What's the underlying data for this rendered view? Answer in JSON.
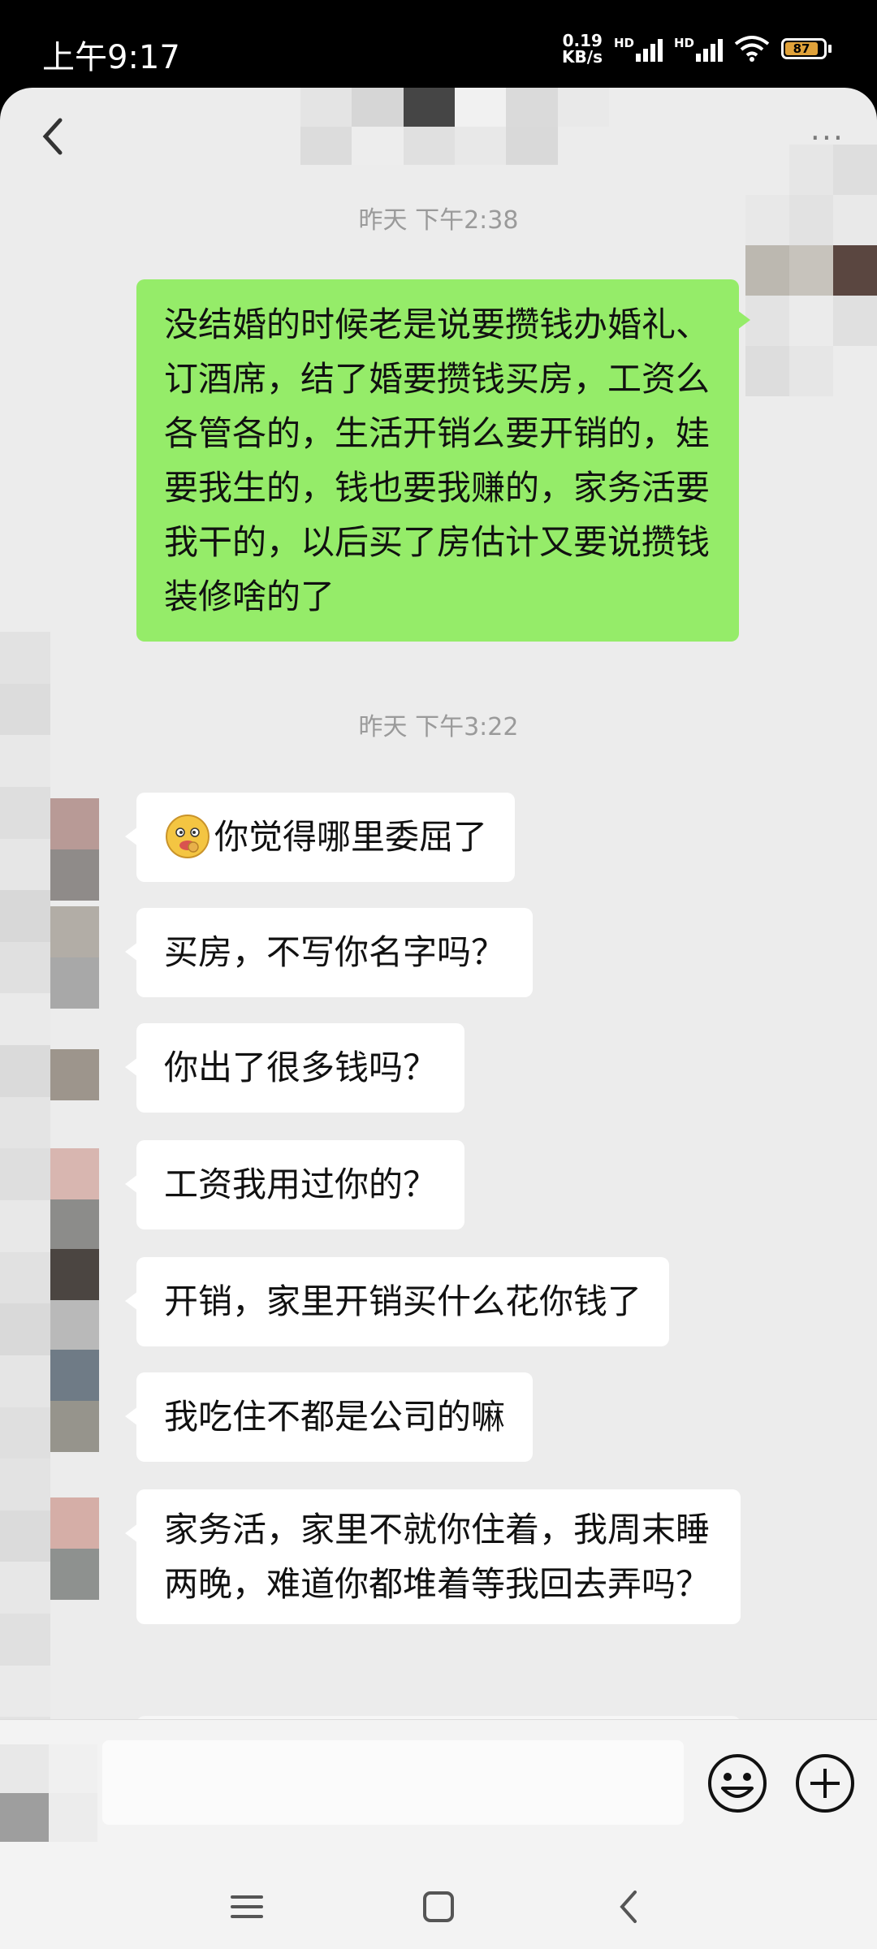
{
  "status_bar": {
    "time": "上午9:17",
    "net_speed_value": "0.19",
    "net_speed_unit": "KB/s",
    "sim1_label": "HD",
    "sim2_label": "HD",
    "battery": "87"
  },
  "chat": {
    "more_label": "···",
    "timestamp_1": "昨天 下午2:38",
    "sent_message": "没结婚的时候老是说要攒钱办婚礼、订酒席，结了婚要攒钱买房，工资么各管各的，生活开销么要开销的，娃要我生的，钱也要我赚的，家务活要我干的，以后买了房估计又要说攒钱装修啥的了",
    "timestamp_2": "昨天 下午3:22",
    "received": [
      "你觉得哪里委屈了",
      "买房，不写你名字吗？",
      "你出了很多钱吗？",
      "工资我用过你的？",
      "开销，家里开销买什么花你钱了",
      "我吃住不都是公司的嘛",
      "家务活，家里不就你住着，我周末睡两晚，难道你都堆着等我回去弄吗？"
    ]
  },
  "icons": {
    "back": "back-chevron-icon",
    "more": "more-dots-icon",
    "emoji": "smiley-icon",
    "plus": "plus-circle-icon",
    "nav_menu": "menu-lines-icon",
    "nav_home": "home-square-icon",
    "nav_back": "nav-back-icon"
  },
  "colors": {
    "sent_bubble": "#95ec69",
    "received_bubble": "#ffffff",
    "chat_background": "#ececec"
  }
}
